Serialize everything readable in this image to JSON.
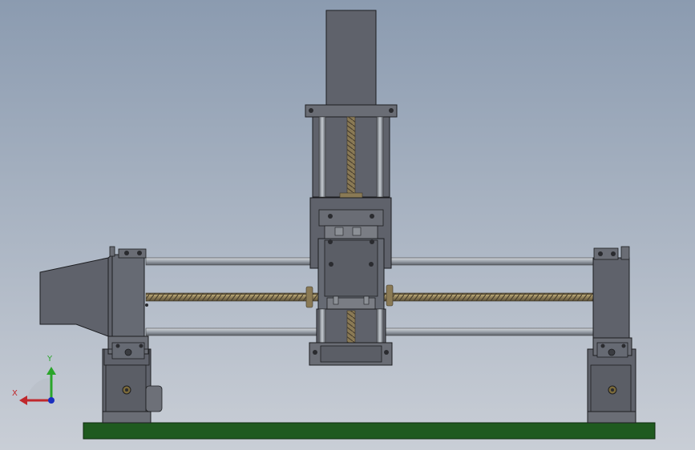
{
  "viewport": {
    "background_top": "#8b9bb0",
    "background_bottom": "#c9ced6"
  },
  "model": {
    "part_color": "#5f626b",
    "part_dark": "#34363c",
    "rod_color": "#9aa0a8",
    "screw_color": "#8a7a55",
    "base_color": "#1f5a1f"
  },
  "triad": {
    "x_label": "X",
    "y_label": "Y",
    "x_color": "#c0282c",
    "y_color": "#2aa52a",
    "z_color": "#1a2fbf"
  }
}
